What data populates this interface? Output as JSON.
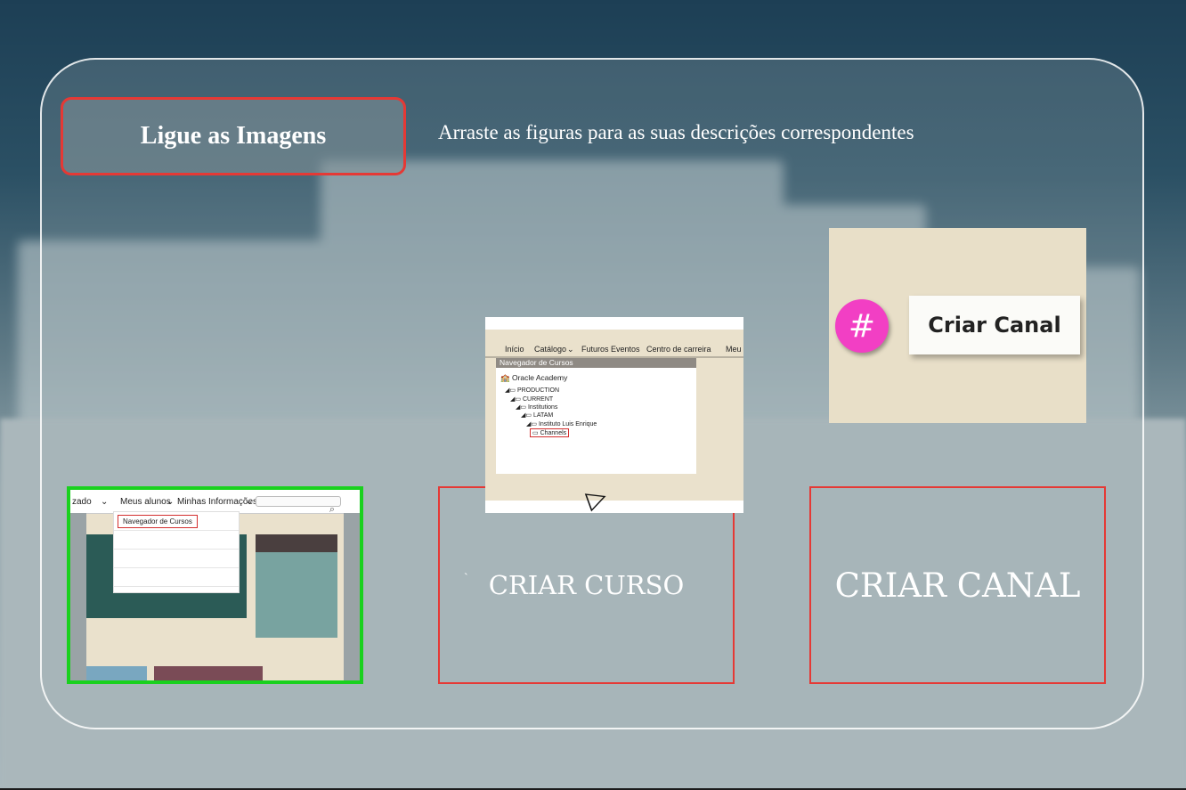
{
  "title": "Ligue as Imagens",
  "instruction": "Arraste as figuras para as suas descrições correspondentes",
  "drop_targets": [
    {
      "label": ""
    },
    {
      "label": "CRIAR CURSO"
    },
    {
      "label": "CRIAR CANAL"
    }
  ],
  "thumb_nav": {
    "items": [
      "zado",
      "Meus alunos",
      "Minhas Informações"
    ],
    "menu_item": "Navegador de Cursos"
  },
  "image_navigator": {
    "menu": [
      "Início",
      "Catálogo",
      "Futuros Eventos",
      "Centro de carreira",
      "Meu"
    ],
    "header": "Navegador de Cursos",
    "root": "Oracle Academy",
    "tree": [
      "PRODUCTION",
      "CURRENT",
      "Institutions",
      "LATAM",
      "Instituto Luis Enrique",
      "Channels"
    ]
  },
  "image_canal": {
    "symbol": "#",
    "label": "Criar Canal"
  },
  "colors": {
    "title_border": "#e53935",
    "drop_border": "#e53935",
    "matched_border": "#19d11e",
    "hash_bg": "#f23fc4"
  }
}
